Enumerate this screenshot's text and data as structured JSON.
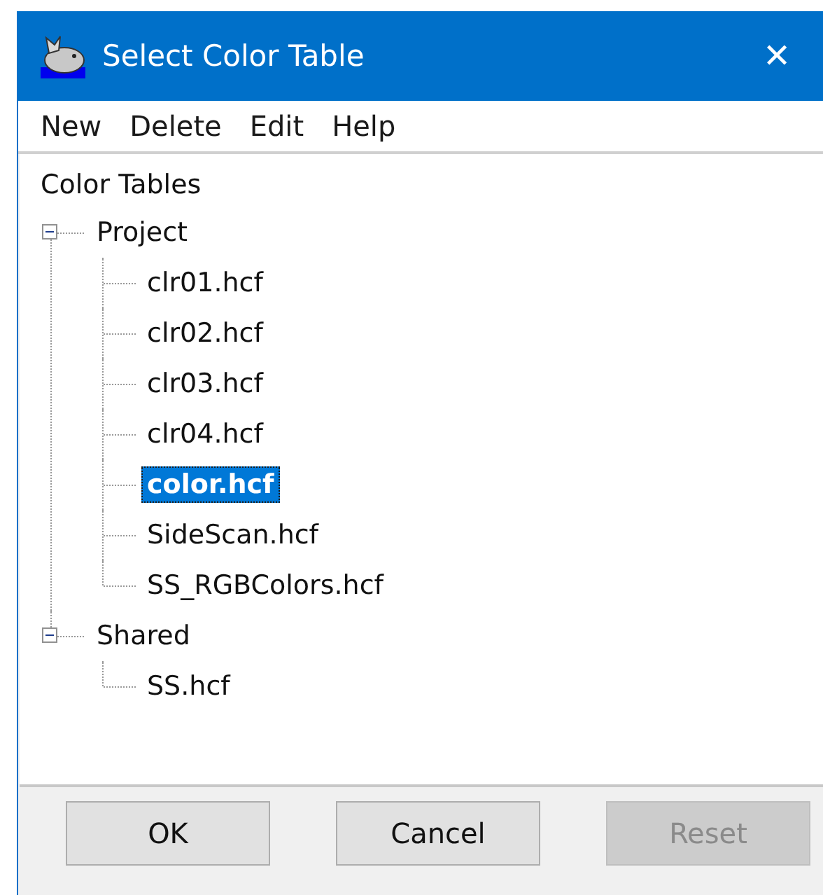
{
  "window": {
    "title": "Select Color Table",
    "close": "✕"
  },
  "menu": [
    "New",
    "Delete",
    "Edit",
    "Help"
  ],
  "tree": {
    "heading": "Color Tables",
    "items": [
      {
        "label": "Project",
        "expanded": true,
        "selected": false,
        "children": [
          {
            "label": "clr01.hcf",
            "selected": false
          },
          {
            "label": "clr02.hcf",
            "selected": false
          },
          {
            "label": "clr03.hcf",
            "selected": false
          },
          {
            "label": "clr04.hcf",
            "selected": false
          },
          {
            "label": "color.hcf",
            "selected": true
          },
          {
            "label": "SideScan.hcf",
            "selected": false
          },
          {
            "label": "SS_RGBColors.hcf",
            "selected": false
          }
        ]
      },
      {
        "label": "Shared",
        "expanded": true,
        "selected": false,
        "children": [
          {
            "label": "SS.hcf",
            "selected": false
          }
        ]
      }
    ]
  },
  "buttons": [
    {
      "label": "OK",
      "disabled": false
    },
    {
      "label": "Cancel",
      "disabled": false
    },
    {
      "label": "Reset",
      "disabled": true
    }
  ]
}
